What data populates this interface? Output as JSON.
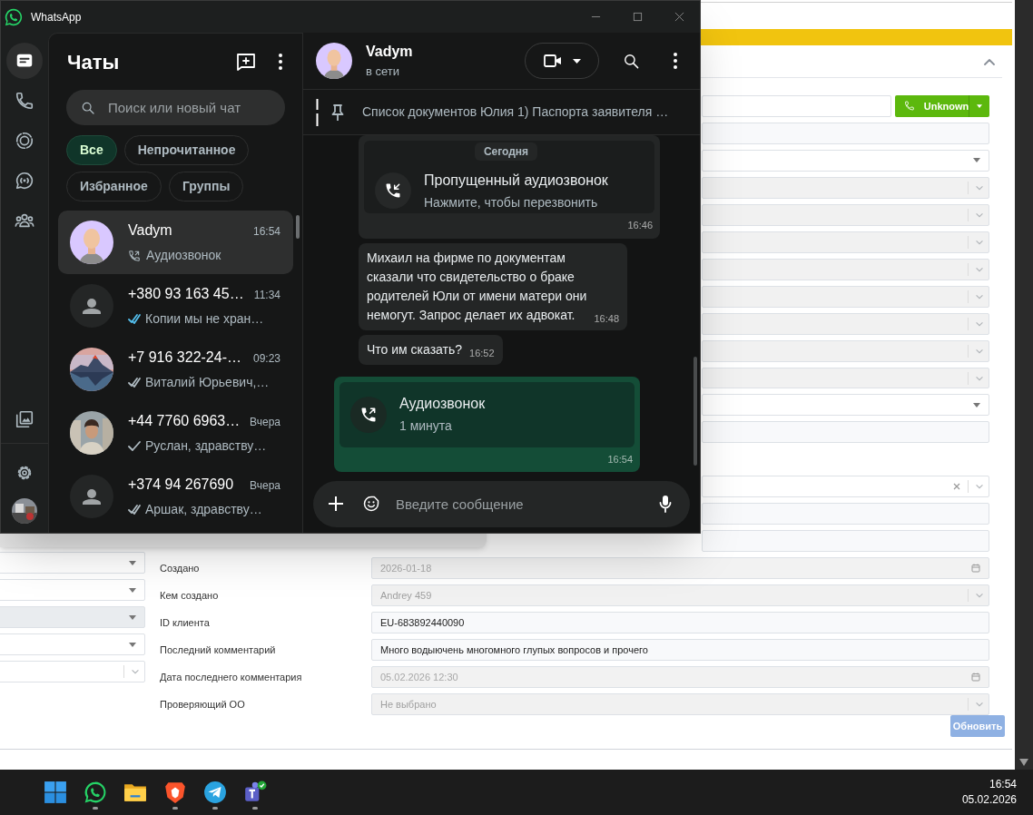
{
  "whatsapp": {
    "title": "WhatsApp",
    "rail": [
      {
        "selected": true
      },
      {
        "selected": false
      },
      {
        "selected": false
      },
      {
        "selected": false
      },
      {
        "selected": false
      }
    ],
    "chat_list": {
      "heading": "Чаты",
      "search_placeholder": "Поиск или новый чат",
      "filters": [
        {
          "label": "Все",
          "selected": true
        },
        {
          "label": "Непрочитанное",
          "selected": false
        },
        {
          "label": "Избранное",
          "selected": false
        },
        {
          "label": "Группы",
          "selected": false
        }
      ],
      "chats": [
        {
          "name": "Vadym",
          "time": "16:54",
          "preview": "Аудиозвонок",
          "receipt": {
            "kind": "call"
          },
          "avatar": {
            "kind": "illustration"
          },
          "selected": true
        },
        {
          "name": "+380 93 163 45…",
          "time": "11:34",
          "preview": "Копии мы не хран…",
          "receipt": {
            "kind": "read"
          },
          "avatar": {
            "kind": "default"
          },
          "selected": false
        },
        {
          "name": "+7 916 322-24-…",
          "time": "09:23",
          "preview": "Виталий Юрьевич,…",
          "receipt": {
            "kind": "delivered"
          },
          "avatar": {
            "kind": "mountain"
          },
          "selected": false
        },
        {
          "name": "+44 7760 6963…",
          "time": "Вчера",
          "preview": "Руслан, здравству…",
          "receipt": {
            "kind": "sent"
          },
          "selected": false
        },
        {
          "name": "+374 94 267690",
          "time": "Вчера",
          "preview": "Аршак, здравству…",
          "receipt": {
            "kind": "delivered"
          },
          "avatar": {
            "kind": "default"
          },
          "selected": false
        }
      ]
    },
    "conversation": {
      "contact": "Vadym",
      "presence": "в сети",
      "pinned": "Список документов Юлия 1) Паспорта заявителя …",
      "date": "Сегодня",
      "messages": [
        {
          "kind": "missed-call",
          "outgoing": false,
          "title": "Пропущенный аудиозвонок",
          "subtitle": "Нажмите, чтобы перезвонить",
          "time": "16:46"
        },
        {
          "kind": "text",
          "outgoing": false,
          "text": "Михаил на фирме по документам сказали что свидетельство о браке родителей Юли от имени матери они немогут. Запрос делает их адвокат.",
          "time": "16:48"
        },
        {
          "kind": "text",
          "outgoing": false,
          "text": "Что им сказать?",
          "time": "16:52"
        },
        {
          "kind": "call",
          "outgoing": true,
          "title": "Аудиозвонок",
          "subtitle": "1 минута",
          "time": "16:54"
        }
      ],
      "composer_placeholder": "Введите сообщение"
    }
  },
  "crm": {
    "call_button": "Unknown",
    "right_fields": [
      {
        "kind": "phone"
      },
      {
        "kind": "input"
      },
      {
        "kind": "select"
      },
      {
        "kind": "locked-select"
      },
      {
        "kind": "locked-select"
      },
      {
        "kind": "locked-select"
      },
      {
        "kind": "locked-select"
      },
      {
        "kind": "locked-select"
      },
      {
        "kind": "locked-select"
      },
      {
        "kind": "locked-select"
      },
      {
        "kind": "locked-select"
      },
      {
        "kind": "select"
      },
      {
        "kind": "input"
      },
      {
        "kind": "gap"
      },
      {
        "kind": "clearable-select"
      },
      {
        "kind": "input"
      },
      {
        "kind": "input"
      },
      {
        "kind": "date",
        "label": "Создано",
        "value": "2026-01-18"
      },
      {
        "kind": "locked-select",
        "label": "Кем создано",
        "value": "Andrey 459"
      },
      {
        "kind": "input",
        "label": "ID клиента",
        "value": "EU-683892440090"
      },
      {
        "kind": "input",
        "label": "Последний комментарий",
        "value": "Много водыючень многомного глупых вопросов и прочего"
      },
      {
        "kind": "date",
        "label": "Дата последнего комментария",
        "value": "05.02.2026 12:30"
      },
      {
        "kind": "locked-select",
        "label": "Проверяющий ОО",
        "value": "Не выбрано"
      }
    ],
    "left_fields": [
      {
        "kind": "select"
      },
      {
        "kind": "select"
      },
      {
        "kind": "shaded-select"
      },
      {
        "kind": "select"
      },
      {
        "kind": "chevron-select"
      }
    ],
    "submit": "Обновить"
  },
  "taskbar": {
    "apps": [
      {
        "running": false
      },
      {
        "running": true
      },
      {
        "running": false
      },
      {
        "running": true
      },
      {
        "running": true
      },
      {
        "running": true
      }
    ],
    "time": "16:54",
    "date": "05.02.2026"
  }
}
